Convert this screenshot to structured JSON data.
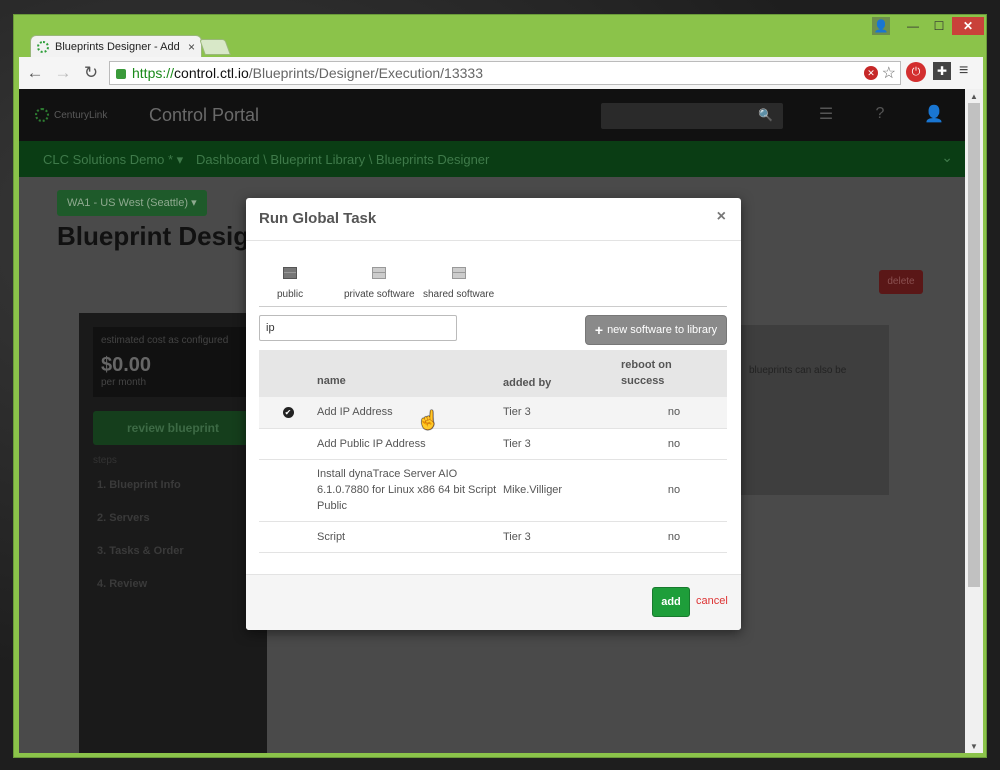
{
  "browser": {
    "tab_title": "Blueprints Designer - Add",
    "tab_close": "×",
    "url_scheme": "https://",
    "url_host": "control.ctl.io",
    "url_path": "/Blueprints/Designer/Execution/13333"
  },
  "app": {
    "brand": "CenturyLink",
    "portal_title": "Control Portal",
    "account": "CLC Solutions Demo * ▾",
    "breadcrumb": "Dashboard \\ Blueprint Library \\ Blueprints Designer",
    "region": "WA1 - US West (Seattle) ▾",
    "page_title": "Blueprint Design",
    "delete_label": "delete",
    "cost_label": "estimated cost as configured",
    "cost_value": "$0.00",
    "cost_unit": "per month",
    "review_label": "review blueprint",
    "steps_label": "steps",
    "steps": [
      "1. Blueprint Info",
      "2. Servers",
      "3. Tasks & Order",
      "4. Review"
    ],
    "right_snippet": "blueprints can also be"
  },
  "modal": {
    "title": "Run Global Task",
    "close": "×",
    "tabs": [
      {
        "label": "public",
        "icon": "archive-box-icon"
      },
      {
        "label": "private software",
        "icon": "box-icon"
      },
      {
        "label": "shared software",
        "icon": "box-icon"
      }
    ],
    "filter_value": "ip",
    "new_software_label": "new software to library",
    "columns": {
      "name": "name",
      "added_by": "added by",
      "reboot": "reboot on success"
    },
    "rows": [
      {
        "name": "Add IP Address",
        "added_by": "Tier 3",
        "reboot": "no",
        "selected": true
      },
      {
        "name": "Add Public IP Address",
        "added_by": "Tier 3",
        "reboot": "no",
        "selected": false
      },
      {
        "name": "Install dynaTrace Server AIO 6.1.0.7880 for Linux x86 64 bit Script Public",
        "added_by": "Mike.Villiger",
        "reboot": "no",
        "selected": false
      },
      {
        "name": "Script",
        "added_by": "Tier 3",
        "reboot": "no",
        "selected": false
      }
    ],
    "add_label": "add",
    "cancel_label": "cancel"
  }
}
